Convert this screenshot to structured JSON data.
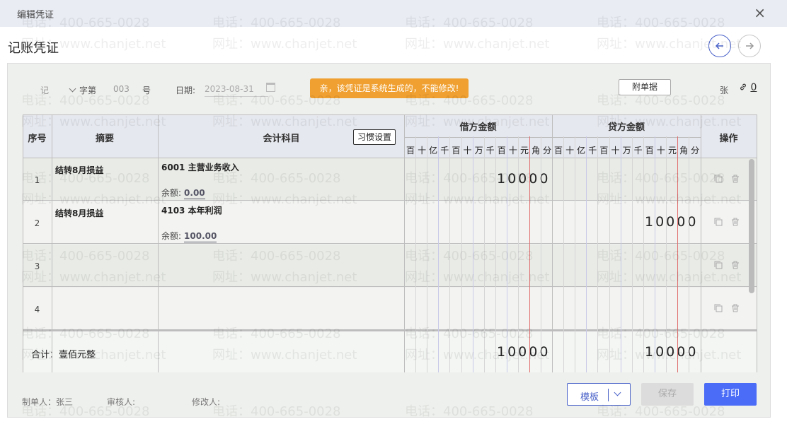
{
  "window": {
    "title": "编辑凭证",
    "close_symbol": "×"
  },
  "page_title": "记账凭证",
  "nav": {
    "prev_symbol": "←",
    "next_symbol": "→"
  },
  "voucher": {
    "type": "记",
    "zi_label": "字第",
    "number": "003",
    "hao_label": "号",
    "date_label": "日期:",
    "date": "2023-08-31",
    "notice": "亲，该凭证是系统生成的，不能修改!",
    "attachment_button": "附单据",
    "zhang_label": "张",
    "attachment_count": "0"
  },
  "table": {
    "headers": {
      "no": "序号",
      "summary": "摘要",
      "account": "会计科目",
      "debit": "借方金额",
      "credit": "贷方金额",
      "ops": "操作"
    },
    "habit_button": "习惯设置",
    "digit_headers": [
      "百",
      "十",
      "亿",
      "千",
      "百",
      "十",
      "万",
      "千",
      "百",
      "十",
      "元",
      "角",
      "分"
    ],
    "rows": [
      {
        "no": "1",
        "summary": "结转8月损益",
        "account": "6001 主营业务收入",
        "balance_label": "余额:",
        "balance": "0.00",
        "debit": "10000",
        "credit": ""
      },
      {
        "no": "2",
        "summary": "结转8月损益",
        "account": "4103 本年利润",
        "balance_label": "余额:",
        "balance": "100.00",
        "debit": "",
        "credit": "10000"
      },
      {
        "no": "3",
        "summary": "",
        "account": "",
        "balance_label": "",
        "balance": "",
        "debit": "",
        "credit": ""
      },
      {
        "no": "4",
        "summary": "",
        "account": "",
        "balance_label": "",
        "balance": "",
        "debit": "",
        "credit": ""
      }
    ],
    "total": {
      "label": "合计：壹佰元整",
      "debit": "10000",
      "credit": "10000"
    }
  },
  "footer": {
    "maker": "制单人：张三",
    "auditor": "审核人:",
    "editor": "修改人:",
    "template_button": "模板",
    "save_button": "保存",
    "print_button": "打印"
  },
  "watermark": {
    "phone": "电话：400-665-0028",
    "site": "网址：www.chanjet.net"
  },
  "colors": {
    "accent": "#4a6cf7",
    "notice": "#f0a030",
    "debit_credit_divider": "#e07070"
  }
}
